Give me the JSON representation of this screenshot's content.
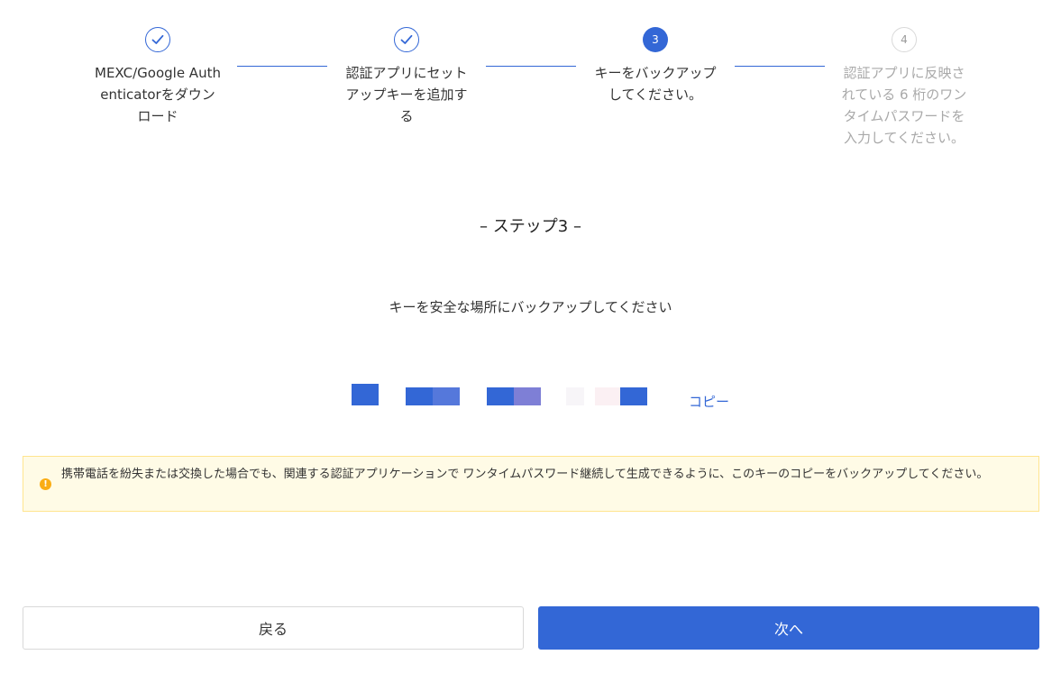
{
  "stepper": {
    "steps": [
      {
        "number": "1",
        "label": "MEXC/Google Authenticatorをダウンロード",
        "state": "done",
        "icon": "check-icon"
      },
      {
        "number": "2",
        "label": "認証アプリにセットアップキーを追加する",
        "state": "done",
        "icon": "check-icon"
      },
      {
        "number": "3",
        "label": "キーをバックアップしてください。",
        "state": "active"
      },
      {
        "number": "4",
        "label": "認証アプリに反映されている 6 桁のワンタイムパスワードを入力してください。",
        "state": "pending"
      }
    ]
  },
  "content": {
    "step_title": "– ステップ3 –",
    "instruction": "キーを安全な場所にバックアップしてください",
    "copy_label": "コピー"
  },
  "warning": {
    "icon": "info-icon",
    "text": "携帯電話を紛失または交換した場合でも、関連する認証アプリケーションで ワンタイムパスワード継続して生成できるように、このキーのコピーをバックアップしてください。"
  },
  "buttons": {
    "back_label": "戻る",
    "next_label": "次へ"
  },
  "colors": {
    "accent": "#3367d6",
    "warning_bg": "#fffbe6",
    "warning_border": "#ffe58f",
    "warning_icon": "#faad14",
    "pending_text": "#a9a9a9"
  }
}
